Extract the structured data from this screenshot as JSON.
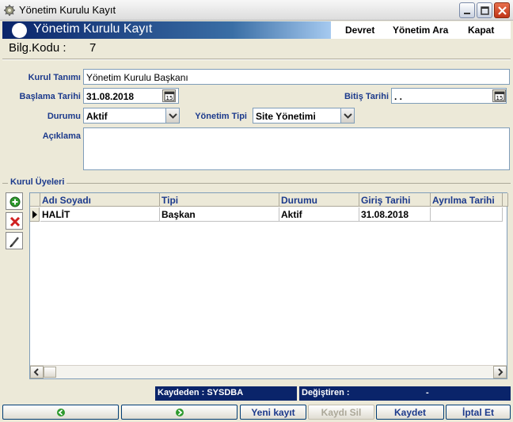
{
  "window": {
    "title": "Yönetim Kurulu Kayıt",
    "icon": "app-icon",
    "controls": [
      "minimize-icon",
      "maximize-icon",
      "close-icon"
    ]
  },
  "header": {
    "title": "Yönetim Kurulu Kayıt",
    "menu": [
      "Devret",
      "Yönetim Ara",
      "Kapat"
    ]
  },
  "info": {
    "label": "Bilg.Kodu :",
    "value": "7"
  },
  "form": {
    "kurul_tanimi": {
      "label": "Kurul Tanımı",
      "value": "Yönetim Kurulu Başkanı"
    },
    "baslama_tarihi": {
      "label": "Başlama Tarihi",
      "value": "31.08.2018"
    },
    "bitis_tarihi": {
      "label": "Bitiş Tarihi",
      "value": " .  ."
    },
    "durumu": {
      "label": "Durumu",
      "value": "Aktif"
    },
    "yonetim_tipi": {
      "label": "Yönetim Tipi",
      "value": "Site Yönetimi"
    },
    "aciklama": {
      "label": "Açıklama",
      "value": ""
    },
    "calendar_glyph": "15"
  },
  "members": {
    "label": "Kurul Üyeleri",
    "columns": [
      "Adı Soyadı",
      "Tipi",
      "Durumu",
      "Giriş Tarihi",
      "Ayrılma Tarihi"
    ],
    "rows": [
      [
        "HALİT",
        "Başkan",
        "Aktif",
        "31.08.2018",
        ""
      ]
    ],
    "tools": [
      "add-icon",
      "delete-icon",
      "edit-icon"
    ]
  },
  "status": {
    "created_by": "Kaydeden : SYSDBA",
    "modified_by": "Değiştiren :",
    "modified_value": "-"
  },
  "buttons": {
    "new": "Yeni kayıt",
    "delete": "Kaydı Sil",
    "save": "Kaydet",
    "cancel": "İptal Et"
  },
  "colors": {
    "accent": "#0a246a",
    "label": "#1c3a8c",
    "background": "#ece9d8"
  }
}
